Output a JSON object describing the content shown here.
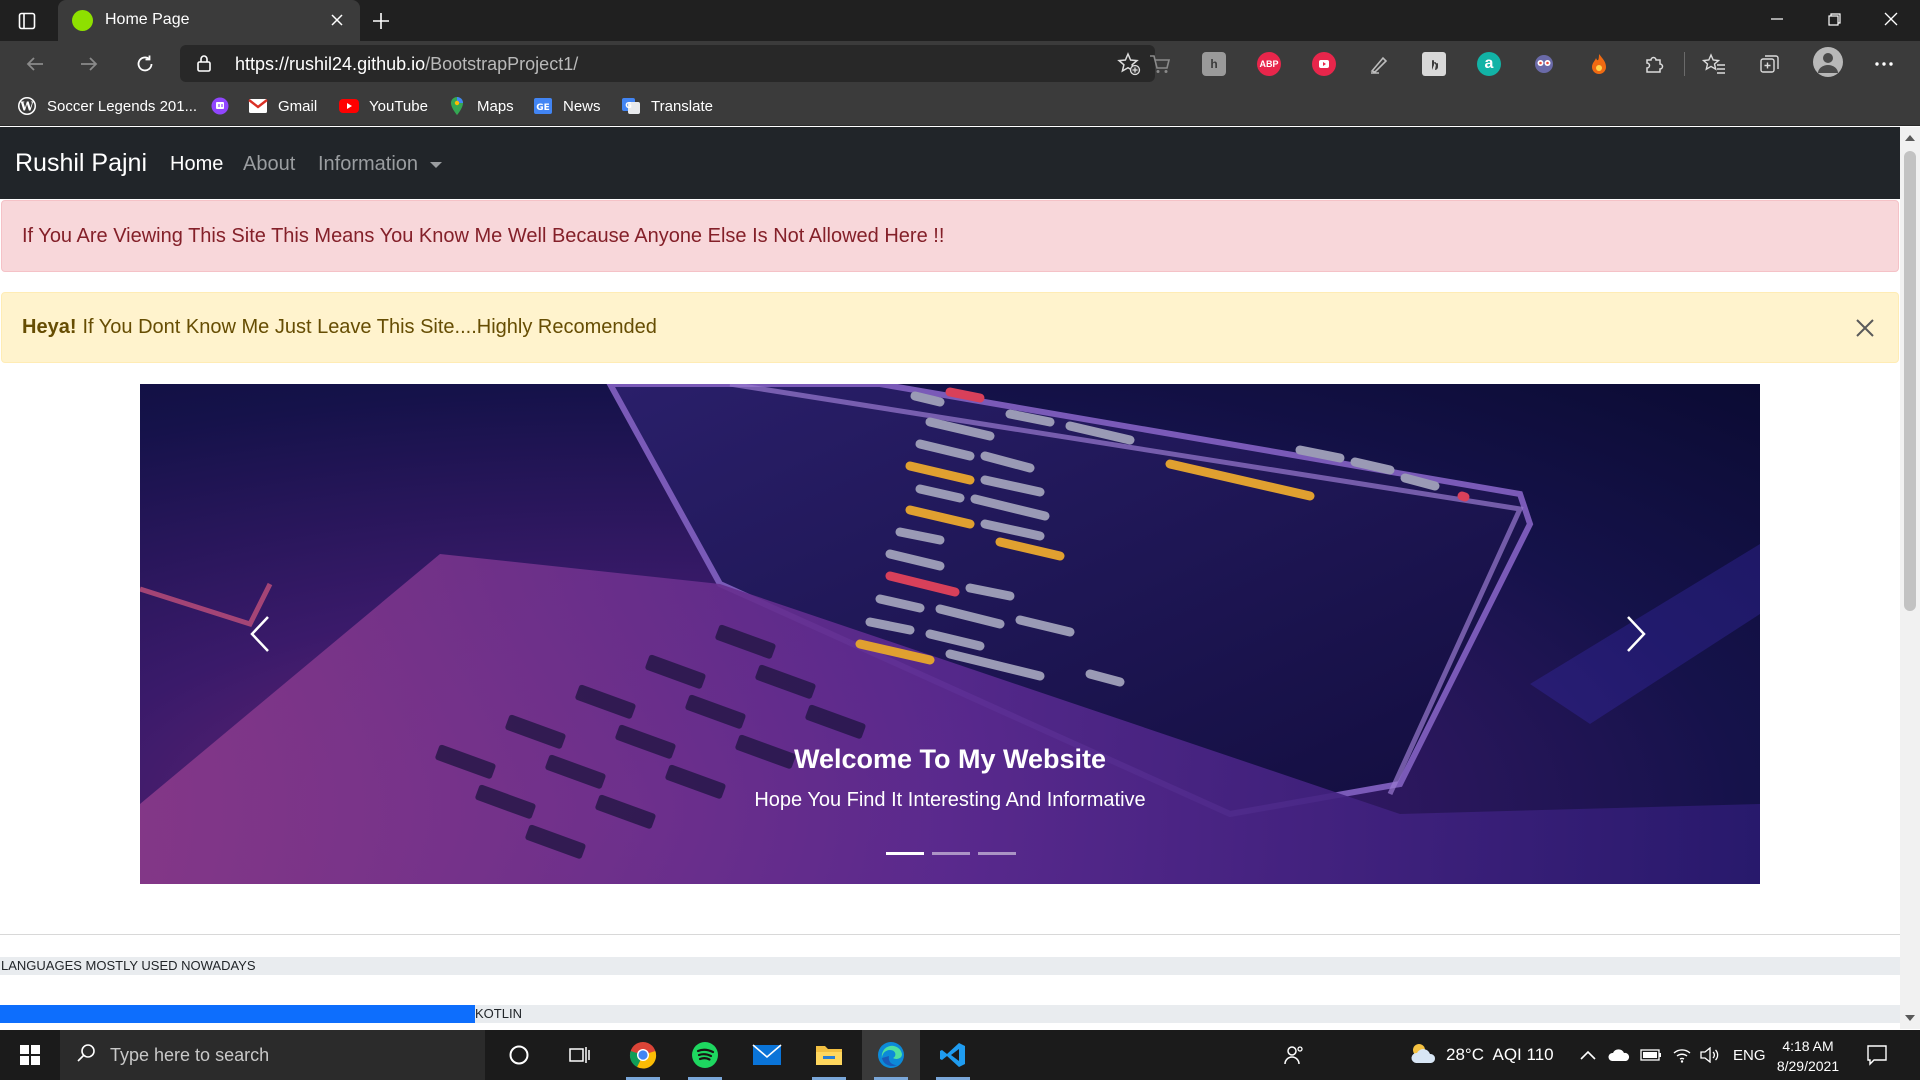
{
  "browser": {
    "tab": {
      "title": "Home Page"
    },
    "url": {
      "host": "https://rushil24.github.io",
      "path": "/BootstrapProject1/"
    },
    "bookmarks": [
      {
        "label": "Soccer Legends 201...",
        "icon": "wordpress-icon"
      },
      {
        "label": "",
        "icon": "twitch-icon"
      },
      {
        "label": "Gmail",
        "icon": "gmail-icon"
      },
      {
        "label": "YouTube",
        "icon": "youtube-icon"
      },
      {
        "label": "Maps",
        "icon": "maps-icon"
      },
      {
        "label": "News",
        "icon": "news-icon"
      },
      {
        "label": "Translate",
        "icon": "translate-icon"
      }
    ],
    "extensions": [
      {
        "icon": "cart-icon",
        "text": ""
      },
      {
        "icon": "h-extension-icon",
        "text": "h"
      },
      {
        "icon": "adblock-icon",
        "text": "ABP"
      },
      {
        "icon": "youtube-ext-icon",
        "text": ""
      },
      {
        "icon": "pen-icon",
        "text": ""
      },
      {
        "icon": "hand-icon",
        "text": ""
      },
      {
        "icon": "a-extension-icon",
        "text": "a"
      },
      {
        "icon": "owl-icon",
        "text": ""
      },
      {
        "icon": "fire-icon",
        "text": ""
      }
    ]
  },
  "site": {
    "brand": "Rushil Pajni",
    "nav": {
      "home": "Home",
      "about": "About",
      "information": "Information"
    },
    "alert_danger": "If You Are Viewing This Site This Means You Know Me Well Because Anyone Else Is Not Allowed Here !!",
    "alert_warning": {
      "bold": "Heya!",
      "text": "If You Dont Know Me Just Leave This Site....Highly Recomended"
    },
    "carousel": {
      "title": "Welcome To My Website",
      "text": "Hope You Find It Interesting And Informative",
      "slides": 3,
      "active_slide": 1
    },
    "languages_label": "LANGUAGES MOSTLY USED NOWADAYS",
    "progress": {
      "label": "KOTLIN",
      "percent": 25
    }
  },
  "taskbar": {
    "search_placeholder": "Type here to search",
    "weather": "28°C  AQI 110",
    "language": "ENG",
    "time": "4:18 AM",
    "date": "8/29/2021"
  },
  "colors": {
    "navbar": "#212529",
    "danger_bg": "#f8d7da",
    "warning_bg": "#fff3cd",
    "progress_bar": "#0d6efd"
  }
}
